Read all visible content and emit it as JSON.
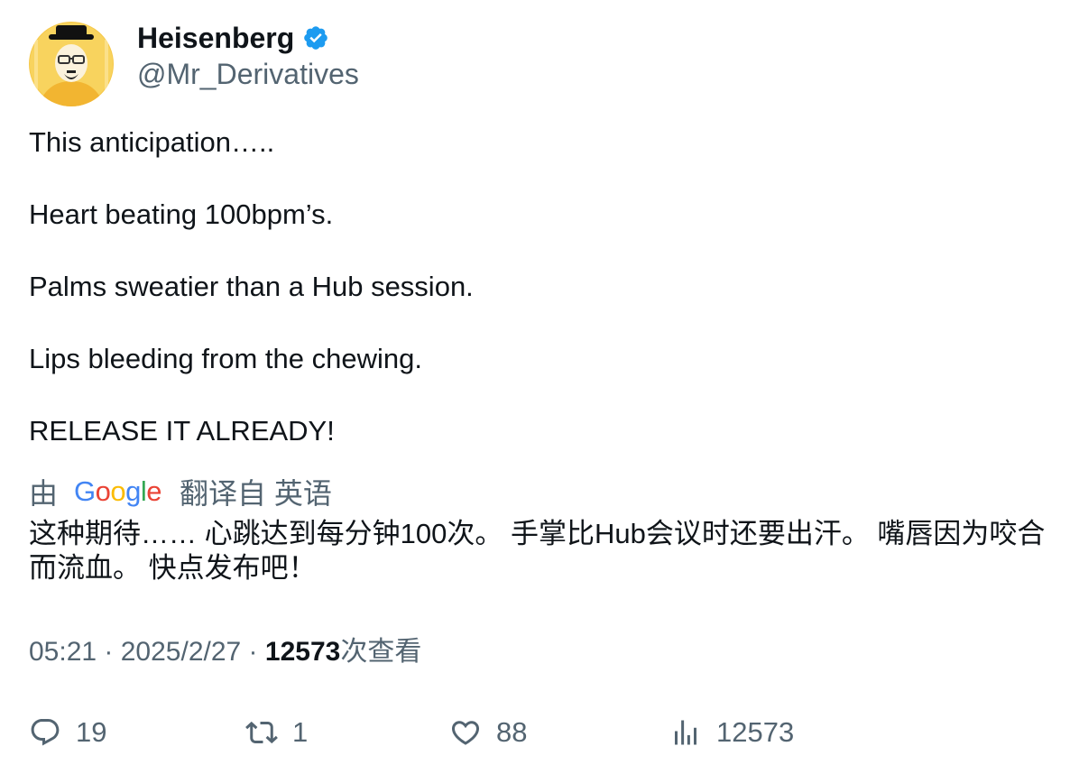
{
  "author": {
    "display_name": "Heisenberg",
    "handle": "@Mr_Derivatives",
    "verified": true,
    "verified_color": "#1d9bf0",
    "avatar_bg": "#f6c84a"
  },
  "tweet": {
    "paragraphs": [
      "This anticipation…..",
      "Heart beating 100bpm’s.",
      "Palms sweatier than a Hub session.",
      "Lips bleeding from the chewing.",
      "RELEASE IT ALREADY!"
    ]
  },
  "translation": {
    "by_label": "由",
    "provider_letters": [
      "G",
      "o",
      "o",
      "g",
      "l",
      "e"
    ],
    "from_label": "翻译自 英语",
    "text": "这种期待…… 心跳达到每分钟100次。 手掌比Hub会议时还要出汗。 嘴唇因为咬合而流血。 快点发布吧！"
  },
  "meta": {
    "time": "05:21",
    "separator": " · ",
    "date": "2025/2/27",
    "views_count": "12573",
    "views_label": "次查看"
  },
  "actions": {
    "replies": "19",
    "retweets": "1",
    "likes": "88",
    "views": "12573",
    "icons": [
      "reply-icon",
      "retweet-icon",
      "like-icon",
      "analytics-icon"
    ]
  }
}
